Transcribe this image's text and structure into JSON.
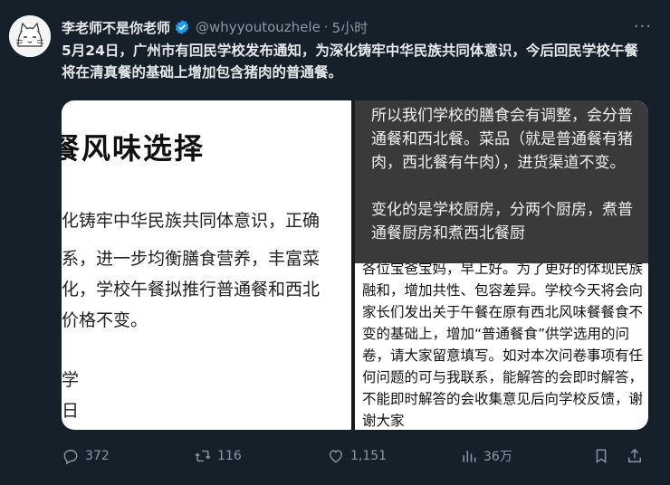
{
  "tweet": {
    "author_name": "李老师不是你老师",
    "handle": "@whyyoutouzhele",
    "separator": "·",
    "time": "5小时",
    "more_label": "···",
    "text": "5月24日，广州市有回民学校发布通知，为深化铸牢中华民族共同体意识，今后回民学校午餐将在清真餐的基础上增加包含猪肉的普通餐。"
  },
  "media": {
    "left_image": {
      "title": "餐风味选择",
      "lines": [
        "化铸牢中华民族共同体意识，正确",
        "系，进一步均衡膳食营养，丰富菜",
        "化，学校午餐拟推行普通餐和西北",
        "价格不变。",
        "",
        "学",
        "日"
      ]
    },
    "right_image": {
      "overlay_text_1": "所以我们学校的膳食会有调整，会分普通餐和西北餐。菜品（就是普通餐有猪肉，西北餐有牛肉），进货渠道不变。",
      "overlay_text_2": "变化的是学校厨房，分两个厨房，煮普通餐厨房和煮西北餐厨",
      "body_text": "各位宝爸宝妈，早上好。为了更好的体现民族融和，增加共性、包容差异。学校今天将会向家长们发出关于午餐在原有西北风味餐餐食不变的基础上，增加“普通餐食”供学选用的问卷，请大家留意填写。如对本次问卷事项有任何问题的可与我联系，能解答的会即时解答，不能即时解答的会收集意见后向学校反馈，谢谢大家"
    }
  },
  "actions": {
    "replies": "372",
    "retweets": "116",
    "likes": "1,151",
    "views": "36万"
  },
  "colors": {
    "background": "#15202b",
    "text": "#e7e9ea",
    "muted": "#8b98a5",
    "verified": "#1d9bf0"
  },
  "icons": [
    "avatar",
    "verified-badge-icon",
    "more-icon",
    "reply-icon",
    "retweet-icon",
    "like-icon",
    "views-icon",
    "bookmark-icon",
    "share-icon"
  ]
}
